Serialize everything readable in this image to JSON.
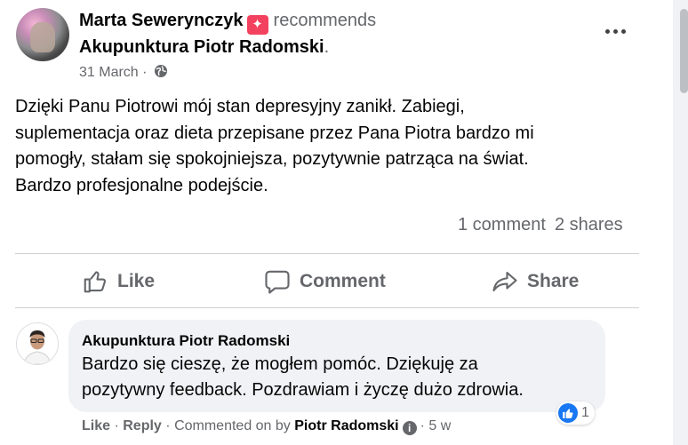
{
  "post": {
    "author": "Marta Sewerynczyk",
    "recommends": "recommends",
    "page": "Akupunktura Piotr Radomski",
    "page_suffix": ".",
    "date": "31 March",
    "date_sep": "·",
    "privacy_icon": "globe-icon",
    "text": [
      "Dzięki Panu Piotrowi mój stan depresyjny zanikł. Zabiegi,",
      "suplementacja oraz dieta przepisane przez Pana Piotra bardzo mi",
      "pomogły, stałam się spokojniejsza, pozytywnie patrząca na świat.",
      "Bardzo profesjonalne podejście."
    ],
    "comments_count": "1 comment",
    "shares_count": "2 shares"
  },
  "actions": {
    "like": "Like",
    "comment": "Comment",
    "share": "Share"
  },
  "comment": {
    "author": "Akupunktura Piotr Radomski",
    "text": [
      "Bardzo się cieszę, że mogłem pomóc. Dziękuję za",
      "pozytywny feedback. Pozdrawiam i życzę dużo zdrowia."
    ],
    "reaction_count": "1",
    "like": "Like",
    "reply": "Reply",
    "sep": "·",
    "commented_on_by": "Commented on by",
    "by_name": "Piotr Radomski",
    "time": "5 w"
  },
  "colors": {
    "recommend_badge": "#f3425f",
    "like_blue": "#1877f2",
    "secondary_text": "#65676b",
    "bubble_bg": "#f0f2f5"
  }
}
